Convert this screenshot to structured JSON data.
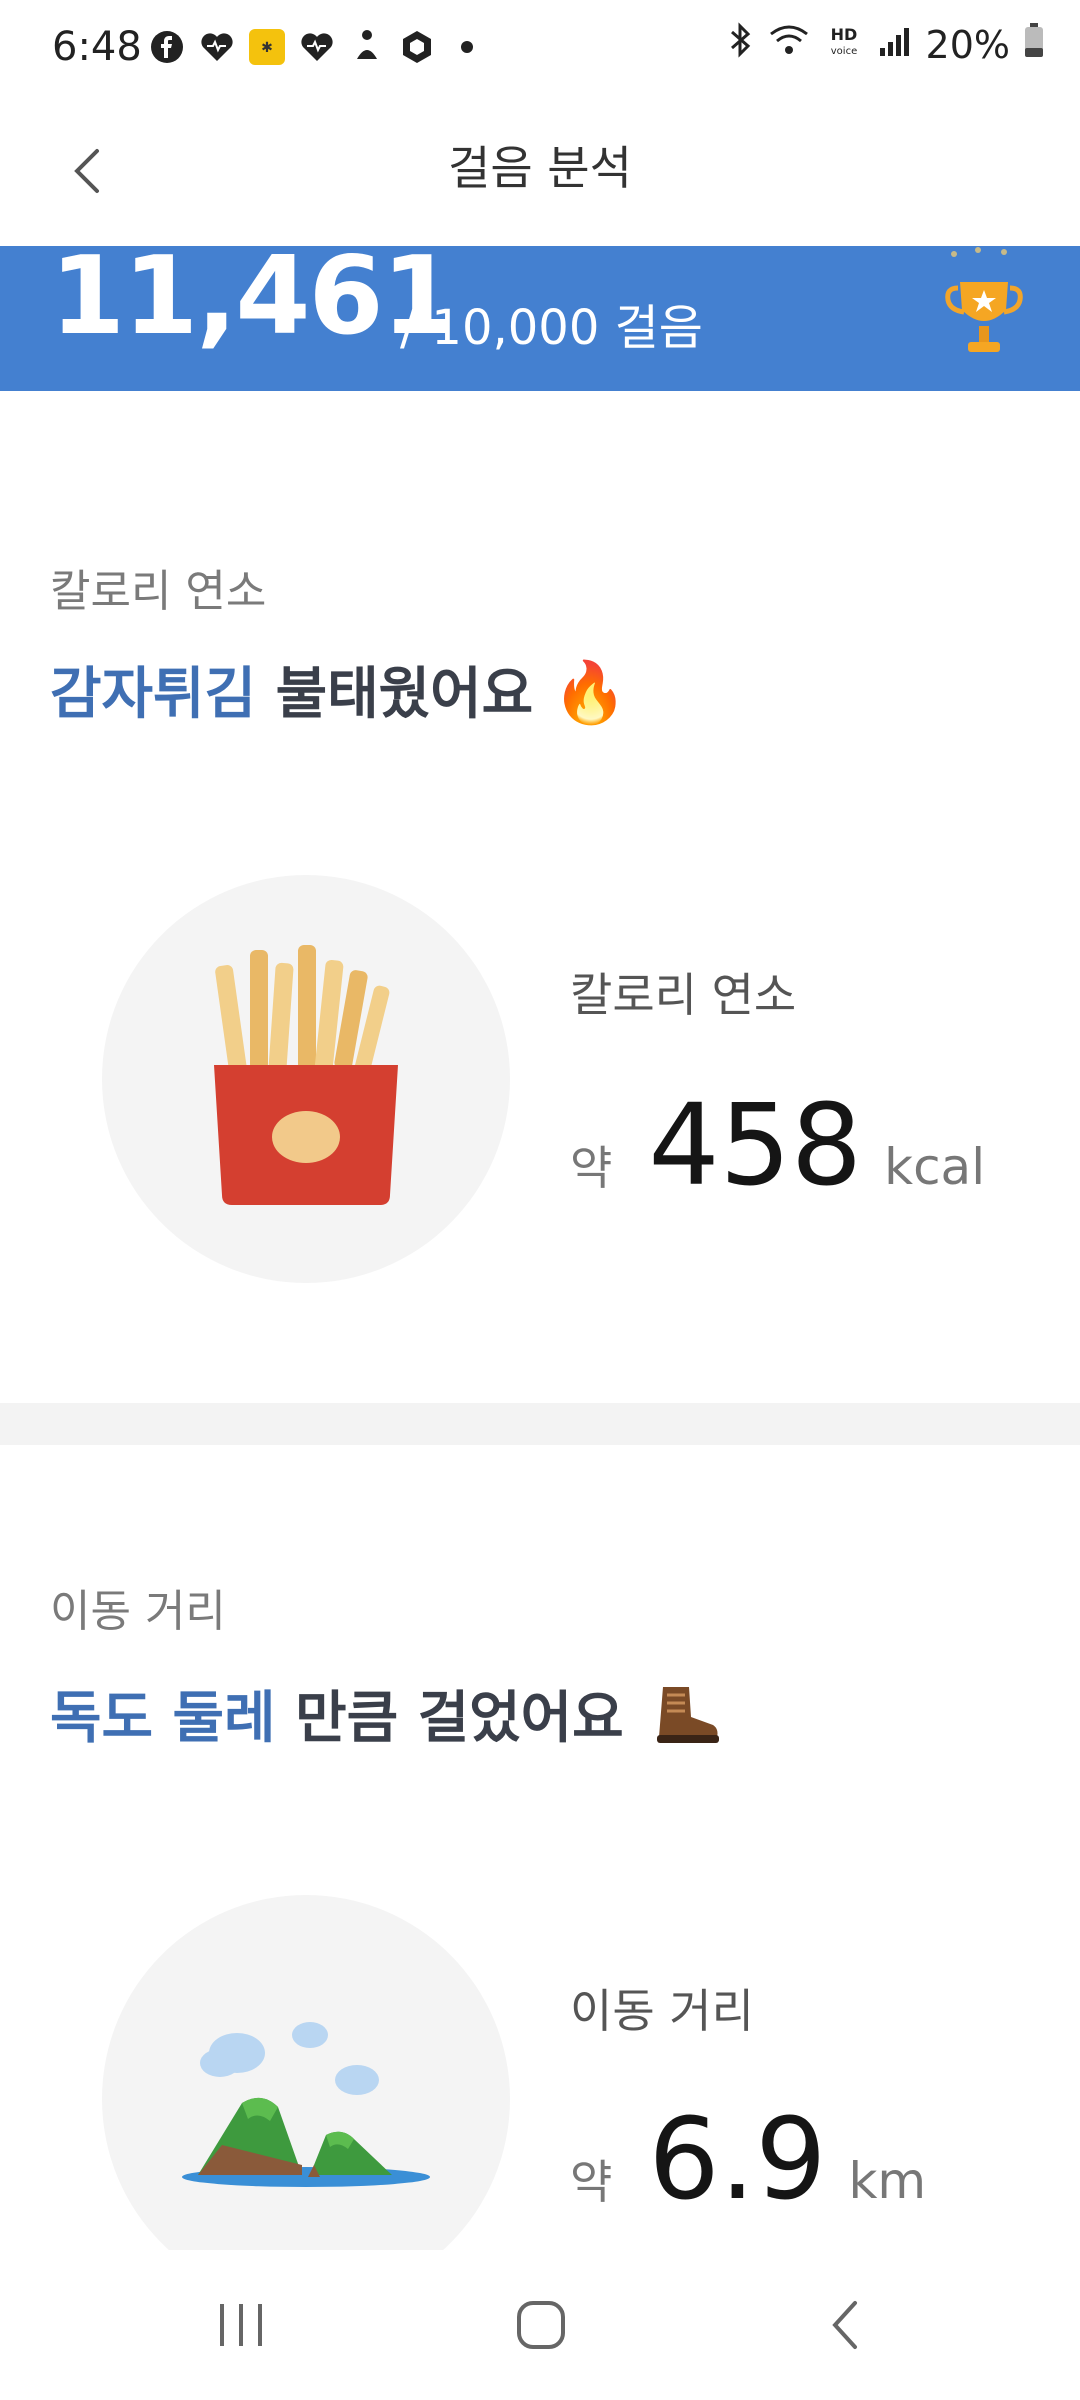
{
  "status_bar": {
    "time": "6:48",
    "left_icons": [
      "facebook-icon",
      "heart-icon",
      "app-badge-icon",
      "heart-icon",
      "yoga-icon",
      "shield-icon",
      "dot-icon"
    ],
    "right_icons": [
      "bluetooth-icon",
      "wifi-icon",
      "hd-voice-icon",
      "signal-icon"
    ],
    "battery": "20%"
  },
  "header": {
    "title": "걸음 분석",
    "back_icon": "chevron-left-icon"
  },
  "banner": {
    "steps": "11,461",
    "goal_text": "/ 10,000 걸음",
    "bg_color": "#4480d0",
    "trophy_icon": "trophy-icon"
  },
  "calorie_section": {
    "label": "칼로리 연소",
    "headline_highlight": "감자튀김",
    "headline_rest": " 불태웠어요",
    "emoji": "🔥",
    "illustration": "french-fries-illustration",
    "stat_label": "칼로리 연소",
    "approx": "약",
    "value": "458",
    "unit": "kcal"
  },
  "distance_section": {
    "label": "이동 거리",
    "headline_highlight": "독도 둘레",
    "headline_rest": " 만큼 걸었어요",
    "emoji_icon": "hiking-boot-icon",
    "illustration": "island-illustration",
    "stat_label": "이동 거리",
    "approx": "약",
    "value": "6.9",
    "unit": "km"
  },
  "nav_bar": {
    "recent_icon": "recent-apps-icon",
    "home_icon": "home-icon",
    "back_icon": "back-icon"
  },
  "colors": {
    "accent_blue": "#3f6fb3",
    "banner_blue": "#4480d0",
    "fries_red": "#d43f30"
  }
}
